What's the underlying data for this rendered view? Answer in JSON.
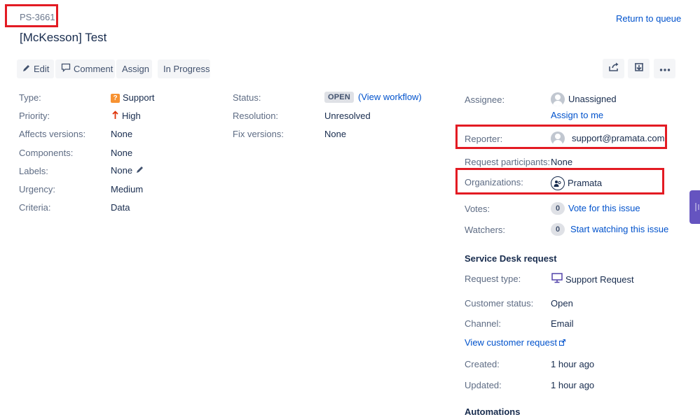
{
  "header": {
    "issue_key": "PS-3661",
    "title": "[McKesson] Test",
    "return_link": "Return to queue"
  },
  "toolbar": {
    "edit": "Edit",
    "comment": "Comment",
    "assign": "Assign",
    "in_progress": "In Progress",
    "share_icon": "share-icon",
    "export_icon": "export-icon",
    "more_icon": "more-icon"
  },
  "details": {
    "type": {
      "label": "Type:",
      "value": "Support",
      "icon": "support-type-icon"
    },
    "priority": {
      "label": "Priority:",
      "value": "High",
      "icon": "arrow-up-icon"
    },
    "affects_versions": {
      "label": "Affects versions:",
      "value": "None"
    },
    "components": {
      "label": "Components:",
      "value": "None"
    },
    "labels": {
      "label": "Labels:",
      "value": "None",
      "icon": "pencil-icon"
    },
    "urgency": {
      "label": "Urgency:",
      "value": "Medium"
    },
    "criteria": {
      "label": "Criteria:",
      "value": "Data"
    },
    "status": {
      "label": "Status:",
      "value": "OPEN",
      "workflow_link": "(View workflow)"
    },
    "resolution": {
      "label": "Resolution:",
      "value": "Unresolved"
    },
    "fix_versions": {
      "label": "Fix versions:",
      "value": "None"
    }
  },
  "people": {
    "assignee": {
      "label": "Assignee:",
      "value": "Unassigned",
      "assign_link": "Assign to me"
    },
    "reporter": {
      "label": "Reporter:",
      "value": "support@pramata.com"
    },
    "participants": {
      "label": "Request participants:",
      "value": "None"
    },
    "organizations": {
      "label": "Organizations:",
      "value": "Pramata"
    },
    "votes": {
      "label": "Votes:",
      "count": "0",
      "link": "Vote for this issue"
    },
    "watchers": {
      "label": "Watchers:",
      "count": "0",
      "link": "Start watching this issue"
    }
  },
  "service_desk": {
    "heading": "Service Desk request",
    "request_type": {
      "label": "Request type:",
      "value": "Support Request",
      "icon": "monitor-icon"
    },
    "customer_status": {
      "label": "Customer status:",
      "value": "Open"
    },
    "channel": {
      "label": "Channel:",
      "value": "Email"
    },
    "view_request_link": "View customer request",
    "created": {
      "label": "Created:",
      "value": "1 hour ago"
    },
    "updated": {
      "label": "Updated:",
      "value": "1 hour ago"
    }
  },
  "automations": {
    "heading": "Automations"
  },
  "colors": {
    "highlight": "#e31b23",
    "link": "#0052cc",
    "text": "#172b4d",
    "label": "#5e6c84",
    "side_tab": "#6554c0"
  }
}
